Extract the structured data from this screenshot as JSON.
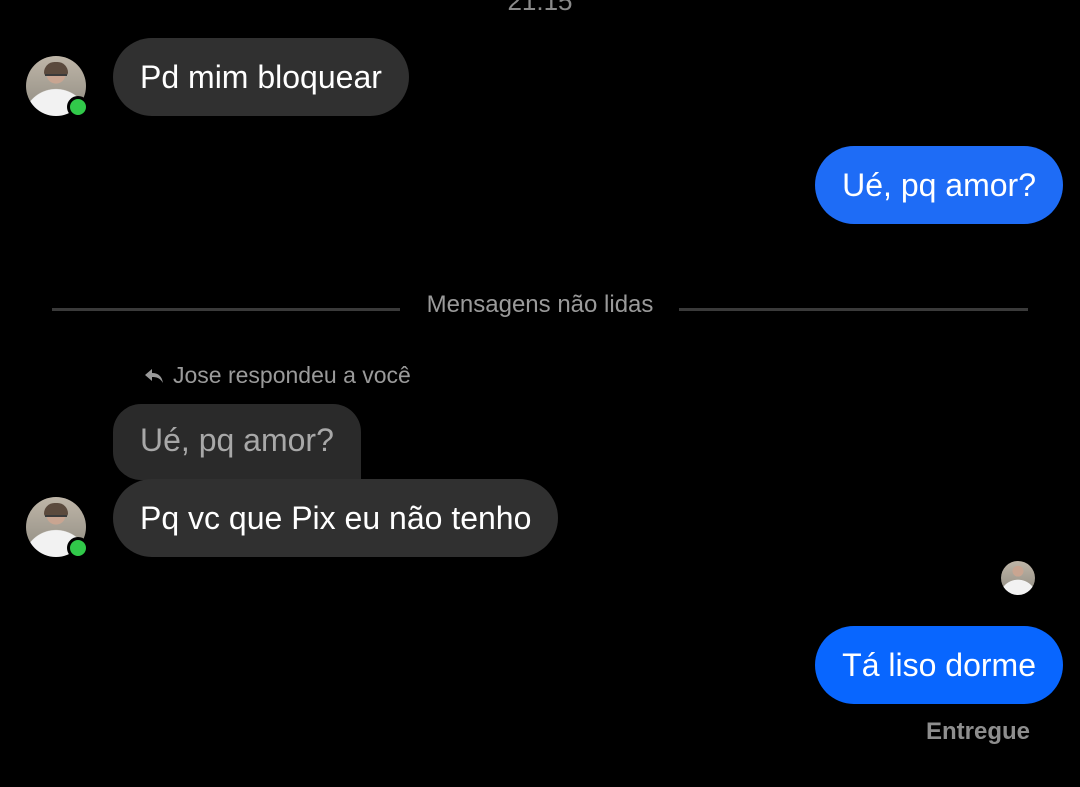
{
  "header": {
    "timestamp": "21:15"
  },
  "messages": [
    {
      "id": "m1",
      "direction": "incoming",
      "text": "Pd mim bloquear"
    },
    {
      "id": "m2",
      "direction": "outgoing",
      "text": "Ué, pq amor?"
    },
    {
      "id": "m3",
      "direction": "incoming",
      "quoted_text": "Ué, pq amor?",
      "text": "Pq vc que Pix eu não tenho"
    },
    {
      "id": "m4",
      "direction": "outgoing",
      "text": "Tá liso dorme",
      "status": "Entregue"
    }
  ],
  "unread_divider": {
    "label": "Mensagens não lidas"
  },
  "reply_hint": {
    "icon": "reply-arrow-icon",
    "text": "Jose respondeu a você"
  },
  "contact": {
    "online": true
  },
  "colors": {
    "background": "#000000",
    "incoming_bubble": "#303030",
    "outgoing_bubble_top": "#1e6cf6",
    "outgoing_bubble_bottom": "#0866ff",
    "online_indicator": "#31c94a"
  }
}
